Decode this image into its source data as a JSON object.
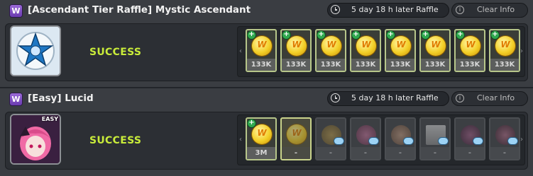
{
  "panels": [
    {
      "tag": "W",
      "title": "[Ascendant Tier Raffle] Mystic Ascendant",
      "timer_text": "5 day 18 h later Raffle",
      "clear_label": "Clear Info",
      "status": "SUCCESS",
      "boss_badge": "",
      "nav_left": "‹",
      "nav_right": "›",
      "slots": [
        {
          "price": "133K",
          "state": "coin"
        },
        {
          "price": "133K",
          "state": "coin"
        },
        {
          "price": "133K",
          "state": "coin"
        },
        {
          "price": "133K",
          "state": "coin"
        },
        {
          "price": "133K",
          "state": "coin"
        },
        {
          "price": "133K",
          "state": "coin"
        },
        {
          "price": "133K",
          "state": "coin"
        },
        {
          "price": "133K",
          "state": "coin"
        }
      ]
    },
    {
      "tag": "W",
      "title": "[Easy] Lucid",
      "timer_text": "5 day 18 h later Raffle",
      "clear_label": "Clear Info",
      "status": "SUCCESS",
      "boss_badge": "EASY",
      "nav_left": "‹",
      "nav_right": "›",
      "slots": [
        {
          "price": "3M",
          "state": "coin"
        },
        {
          "price": "-",
          "state": "selected"
        },
        {
          "price": "-",
          "state": "locked"
        },
        {
          "price": "-",
          "state": "locked"
        },
        {
          "price": "-",
          "state": "locked"
        },
        {
          "price": "-",
          "state": "locked"
        },
        {
          "price": "-",
          "state": "locked"
        },
        {
          "price": "-",
          "state": "locked"
        }
      ]
    }
  ],
  "icons": {
    "tag": "w-tag-icon",
    "timer": "clock-icon",
    "clear": "info-circle-icon",
    "coin": "meso-coin-icon",
    "plus": "plus-icon",
    "cloud": "cloud-icon"
  },
  "colors": {
    "success": "#c9ec3a",
    "tag": "#8a58d0",
    "add": "#2fa84e"
  },
  "coin_glyph": "W",
  "plus_glyph": "+"
}
